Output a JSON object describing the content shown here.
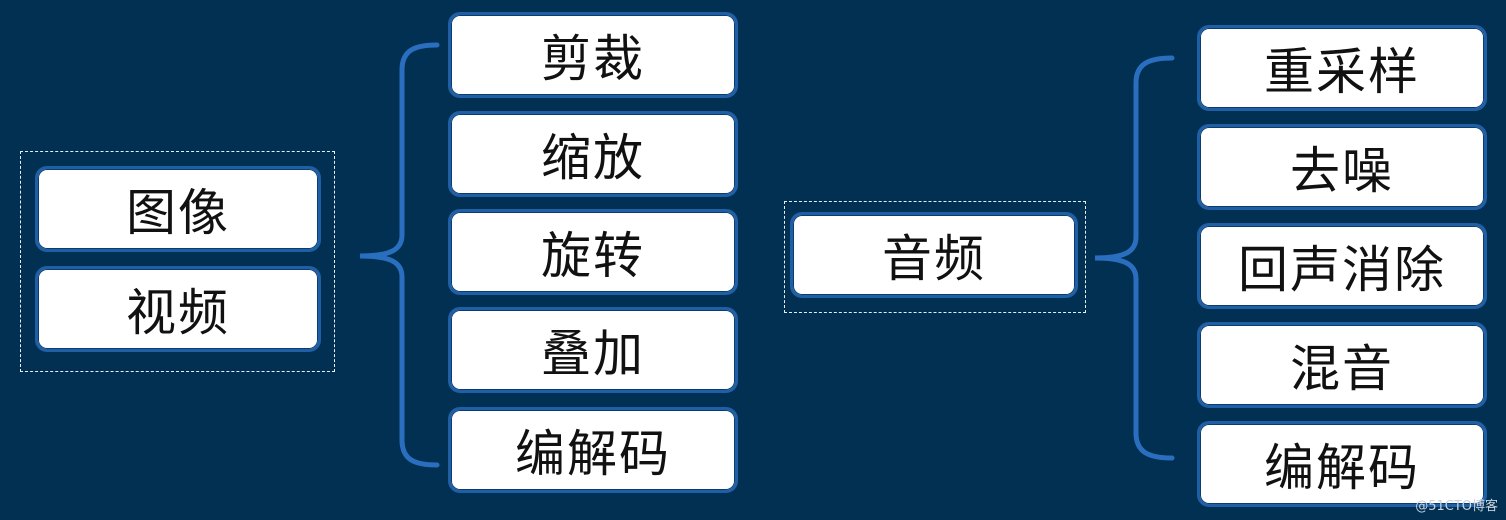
{
  "image_video_group": {
    "items": [
      "图像",
      "视频"
    ]
  },
  "video_ops": [
    "剪裁",
    "缩放",
    "旋转",
    "叠加",
    "编解码"
  ],
  "audio_group": {
    "label": "音频"
  },
  "audio_ops": [
    "重采样",
    "去噪",
    "回声消除",
    "混音",
    "编解码"
  ],
  "watermark": "@51CTO博客",
  "colors": {
    "background": "#023052",
    "node_fill": "#ffffff",
    "node_border": "#1f5fa6",
    "brace": "#2a6fbf"
  }
}
